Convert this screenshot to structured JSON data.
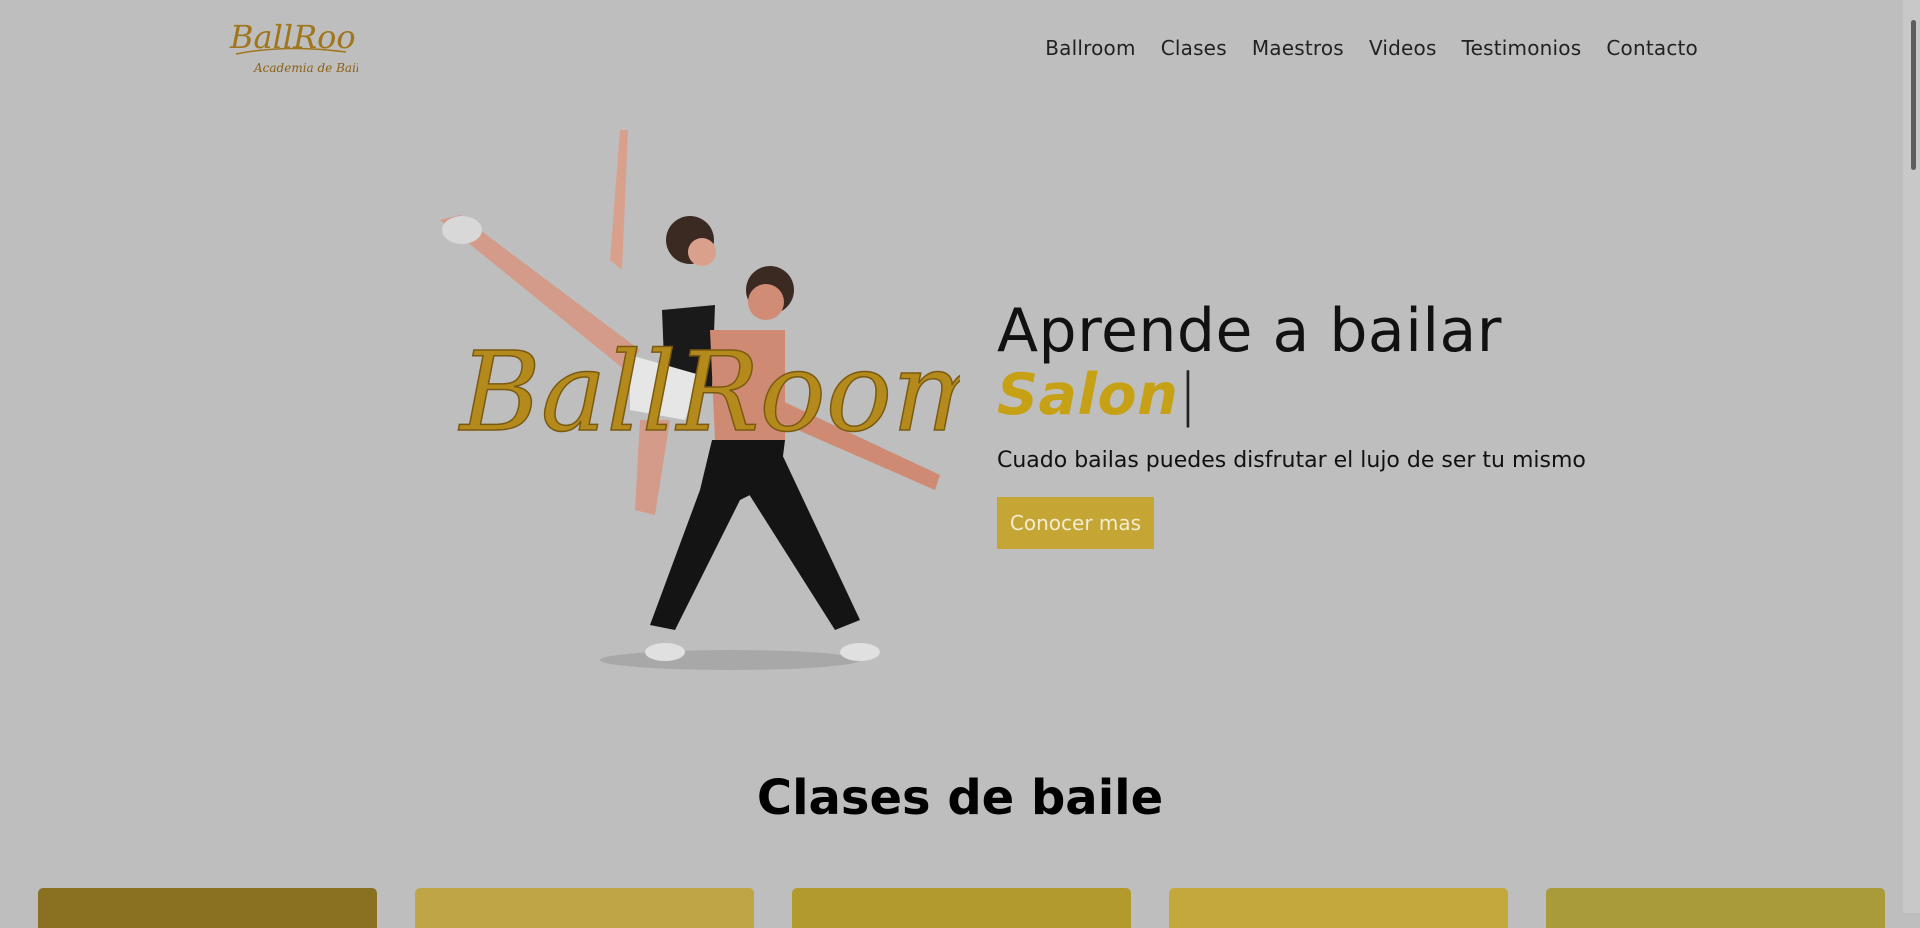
{
  "header": {
    "logo": {
      "brand": "BallRoom",
      "tagline": "Academia de Baile"
    },
    "nav": [
      "Ballroom",
      "Clases",
      "Maestros",
      "Videos",
      "Testimonios",
      "Contacto"
    ]
  },
  "hero": {
    "headline": "Aprende a bailar",
    "typed_word": "Salon",
    "cursor": "|",
    "subtitle": "Cuado bailas puedes disfrutar el lujo de ser tu mismo",
    "cta_label": "Conocer mas",
    "image_overlay_text": "BallRoom"
  },
  "section": {
    "title": "Clases de baile"
  },
  "cards": [
    {
      "color": "#8a7121"
    },
    {
      "color": "#bfa546"
    },
    {
      "color": "#b39a2c"
    },
    {
      "color": "#c3a83b"
    },
    {
      "color": "#a99a3a"
    }
  ],
  "colors": {
    "accent": "#c6a115",
    "button": "#c5a635",
    "background": "#bebebe"
  }
}
